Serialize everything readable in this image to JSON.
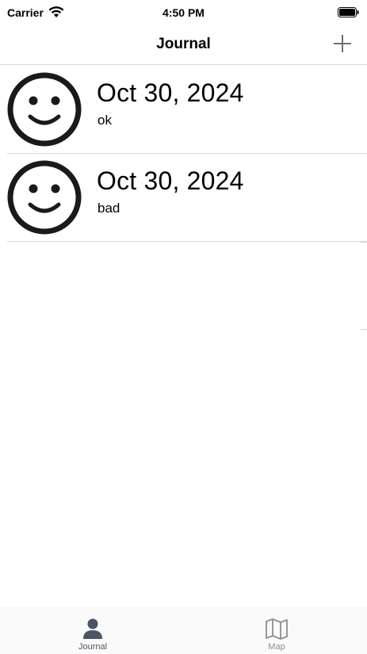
{
  "status_bar": {
    "carrier": "Carrier",
    "time": "4:50 PM"
  },
  "nav": {
    "title": "Journal",
    "add_icon": "plus-icon"
  },
  "entries": [
    {
      "icon": "smiley-face-icon",
      "date": "Oct 30, 2024",
      "note": "ok"
    },
    {
      "icon": "smiley-face-icon",
      "date": "Oct 30, 2024",
      "note": "bad"
    }
  ],
  "tabs": [
    {
      "label": "Journal",
      "icon": "person-icon",
      "selected": true
    },
    {
      "label": "Map",
      "icon": "map-icon",
      "selected": false
    }
  ],
  "colors": {
    "separator": "#d9d9d9",
    "tab_selected": "#4b5563",
    "tab_unselected": "#8e8e93"
  }
}
